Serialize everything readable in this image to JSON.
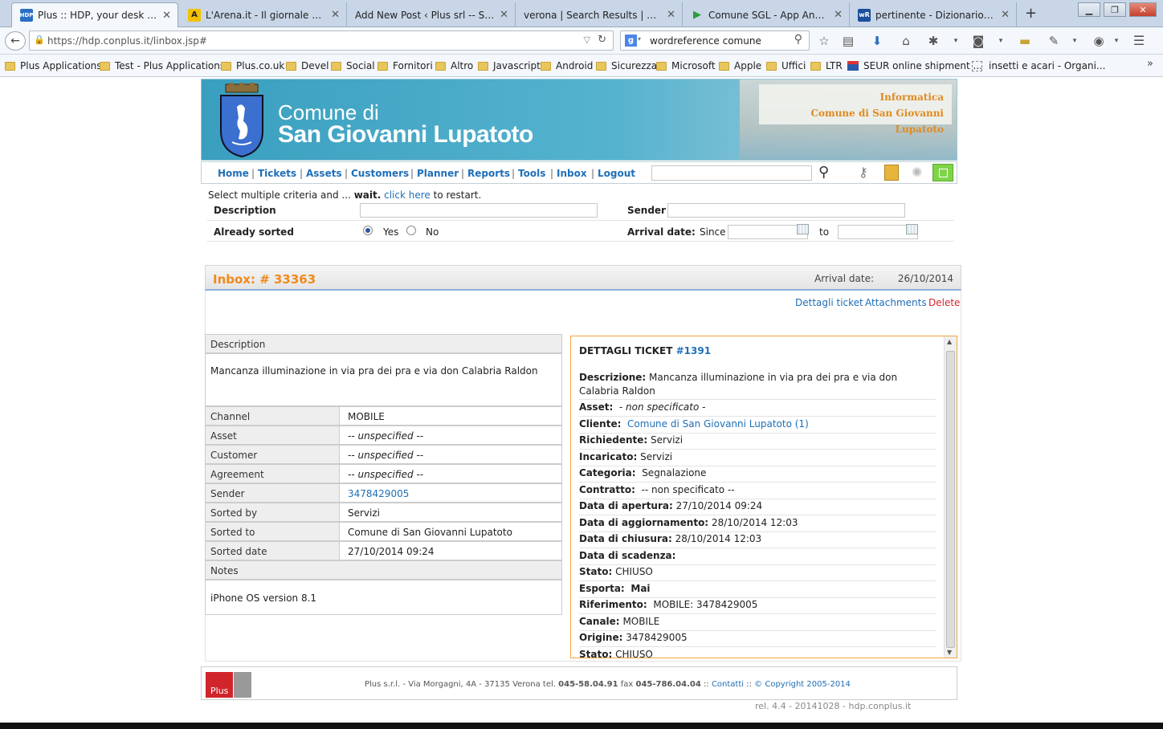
{
  "browser": {
    "tabs": [
      {
        "title": "Plus :: HDP, your desk nee...",
        "active": true
      },
      {
        "title": "L'Arena.it - Il giornale di V..."
      },
      {
        "title": "Add New Post ‹ Plus srl -- Soft..."
      },
      {
        "title": "verona | Search Results | Plus sr..."
      },
      {
        "title": "Comune SGL - App Androi..."
      },
      {
        "title": "pertinente - Dizionario itali..."
      }
    ],
    "url": "https://hdp.conplus.it/linbox.jsp#",
    "search_value": "wordreference comune",
    "bookmarks": [
      "Plus Applications",
      "Test - Plus Applications",
      "Plus.co.uk",
      "Devel",
      "Social",
      "Fornitori",
      "Altro",
      "Javascript",
      "Android",
      "Sicurezza",
      "Microsoft",
      "Apple",
      "Uffici",
      "LTR",
      "SEUR online shipment ...",
      "insetti e acari - Organi..."
    ]
  },
  "banner": {
    "line1": "Comune di",
    "line2": "San Giovanni Lupatoto",
    "info1": "Informatica",
    "info2": "Comune di San Giovanni Lupatoto"
  },
  "menu": [
    "Home",
    "Tickets",
    "Assets",
    "Customers",
    "Planner",
    "Reports",
    "Tools",
    "Inbox",
    "Logout"
  ],
  "filters": {
    "hint_pre": "Select multiple criteria and ...",
    "hint_wait": "wait.",
    "hint_link": "click here",
    "hint_post": "to restart.",
    "description_label": "Description",
    "sender_label": "Sender",
    "sorted_label": "Already sorted",
    "yes": "Yes",
    "no": "No",
    "arrival_label": "Arrival date:",
    "since": "Since",
    "to": "to"
  },
  "inbox": {
    "title": "Inbox: # 33363",
    "arrival_label": "Arrival date:",
    "arrival_value": "26/10/2014",
    "actions": [
      "Dettagli ticket",
      "Attachments",
      "Delete"
    ],
    "description_label": "Description",
    "description_text": "Mancanza illuminazione in via pra dei pra e via don Calabria Raldon",
    "fields": [
      {
        "label": "Channel",
        "value": "MOBILE"
      },
      {
        "label": "Asset",
        "value": "-- unspecified --"
      },
      {
        "label": "Customer",
        "value": "-- unspecified --"
      },
      {
        "label": "Agreement",
        "value": "-- unspecified --"
      },
      {
        "label": "Sender",
        "value": "3478429005"
      },
      {
        "label": "Sorted by",
        "value": "Servizi"
      },
      {
        "label": "Sorted to",
        "value": "Comune di San Giovanni Lupatoto"
      },
      {
        "label": "Sorted date",
        "value": "27/10/2014 09:24"
      }
    ],
    "notes_label": "Notes",
    "notes_text": "iPhone OS version 8.1"
  },
  "ticket": {
    "heading": "DETTAGLI TICKET",
    "number": "#1391",
    "rows": [
      {
        "k": "Descrizione:",
        "v": "Mancanza illuminazione in via pra dei pra e via don Calabria Raldon"
      },
      {
        "k": "Asset:",
        "v": "- non specificato -"
      },
      {
        "k": "Cliente:",
        "v": "Comune di San Giovanni Lupatoto (1)"
      },
      {
        "k": "Richiedente:",
        "v": "Servizi"
      },
      {
        "k": "Incaricato:",
        "v": "Servizi"
      },
      {
        "k": "Categoria:",
        "v": "Segnalazione"
      },
      {
        "k": "Contratto:",
        "v": "-- non specificato --"
      },
      {
        "k": "Data di apertura:",
        "v": "27/10/2014 09:24"
      },
      {
        "k": "Data di aggiornamento:",
        "v": "28/10/2014 12:03"
      },
      {
        "k": "Data di chiusura:",
        "v": "28/10/2014 12:03"
      },
      {
        "k": "Data di scadenza:",
        "v": ""
      },
      {
        "k": "Stato:",
        "v": "CHIUSO"
      },
      {
        "k": "Esporta:",
        "v": "Mai"
      },
      {
        "k": "Riferimento:",
        "v": "MOBILE: 3478429005"
      },
      {
        "k": "Canale:",
        "v": "MOBILE"
      },
      {
        "k": "Origine:",
        "v": "3478429005"
      },
      {
        "k": "Stato:",
        "v": "CHIUSO"
      }
    ]
  },
  "footer": {
    "logo": "Plus",
    "text_pre": "Plus s.r.l. - Via Morgagni, 4A - 37135 Verona tel.",
    "tel": "045-58.04.91",
    "fax_label": "fax",
    "fax": "045-786.04.04",
    "sep": "::",
    "contacts": "Contatti",
    "copyright": "© Copyright 2005-2014",
    "release": "rel. 4.4 - 20141028 - hdp.conplus.it"
  }
}
